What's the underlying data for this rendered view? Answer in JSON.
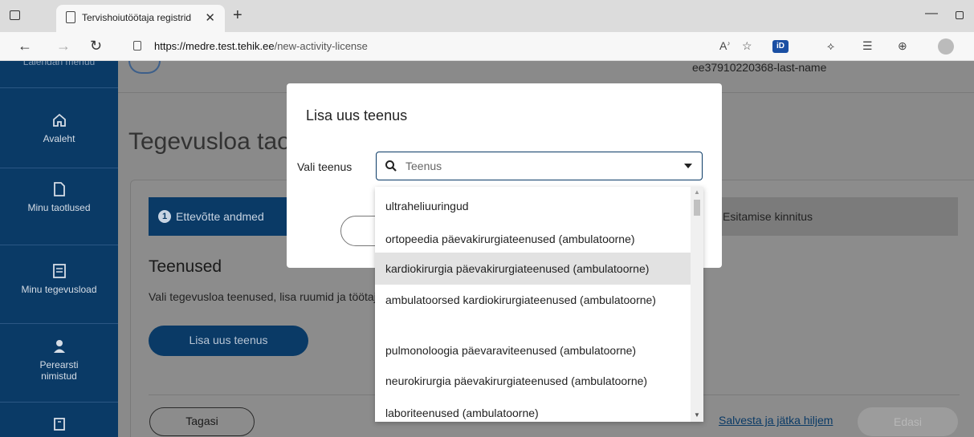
{
  "browser": {
    "tab_title": "Tervishoiutöötaja registrid",
    "tab_close": "✕",
    "new_tab": "+",
    "url_host": "https://medre.test.tehik.ee",
    "url_path": "/new-activity-license",
    "read_aloud": "A₃"
  },
  "sidebar": {
    "menu_label": "Laiendan menüü",
    "items": [
      {
        "label": "Avaleht",
        "icon": "home-icon"
      },
      {
        "label": "Minu taotlused",
        "icon": "document-icon"
      },
      {
        "label": "Minu tegevusload",
        "icon": "license-icon"
      },
      {
        "label": "Perearsti nimistud",
        "icon": "doctor-icon"
      },
      {
        "label": "",
        "icon": "building-icon"
      }
    ]
  },
  "header": {
    "user_name": "ee37910220368-last-name"
  },
  "page": {
    "title": "Tegevusloa taotlus",
    "step_active_number": "1",
    "step_active_label": "Ettevõtte andmed",
    "step_other_label": "Esitamise kinnitus",
    "section_title": "Teenused",
    "section_desc": "Vali tegevusloa teenused, lisa ruumid ja töötajad.",
    "add_service_button": "Lisa uus teenus",
    "back_button": "Tagasi",
    "save_link": "Salvesta ja jätka hiljem",
    "next_button": "Edasi"
  },
  "modal": {
    "title": "Lisa uus teenus",
    "field_label": "Vali teenus",
    "select_placeholder": "Teenus",
    "options": [
      "ultraheliuuringud",
      "ortopeedia päevakirurgiateenused (ambulatoorne)",
      "kardiokirurgia päevakirurgiateenused (ambulatoorne)",
      "ambulatoorsed kardiokirurgiateenused (ambulatoorne)",
      "pulmonoloogia päevaraviteenused (ambulatoorne)",
      "neurokirurgia päevakirurgiateenused (ambulatoorne)",
      "laboriteenused (ambulatoorne)"
    ],
    "selected_index": 2
  },
  "colors": {
    "brand": "#0a3a66",
    "overlay": "#8a8a8a",
    "selected_option": "#e2e2e2"
  }
}
